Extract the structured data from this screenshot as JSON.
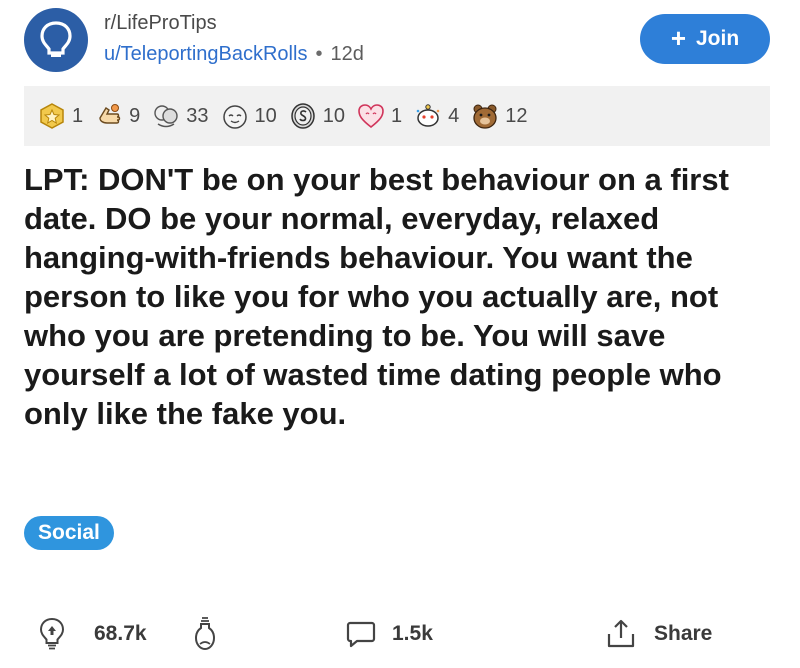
{
  "header": {
    "subreddit": "r/LifeProTips",
    "username": "u/TeleportingBackRolls",
    "separator": "•",
    "age": "12d",
    "join_plus": "+",
    "join_label": "Join",
    "avatar_icon": "lightbulb-icon"
  },
  "awards": [
    {
      "icon": "gold-medal-icon",
      "count": "1"
    },
    {
      "icon": "helpful-hand-icon",
      "count": "9"
    },
    {
      "icon": "wholesome-hug-icon",
      "count": "33"
    },
    {
      "icon": "silver-face-icon",
      "count": "10"
    },
    {
      "icon": "coin-icon",
      "count": "10"
    },
    {
      "icon": "heart-eyes-icon",
      "count": "1"
    },
    {
      "icon": "party-snoo-icon",
      "count": "4"
    },
    {
      "icon": "bear-icon",
      "count": "12"
    }
  ],
  "post": {
    "title": "LPT: DON'T be on your best behaviour on a first date. DO be your normal, everyday, relaxed hanging-with-friends behaviour. You want the person to like you for who you actually are, not who you are pretending to be. You will save yourself a lot of wasted time dating people who only like the fake you.",
    "flair": "Social"
  },
  "actions": {
    "score": "68.7k",
    "comments": "1.5k",
    "share": "Share"
  },
  "colors": {
    "join_button": "#2e7fd8",
    "flair": "#2f95de",
    "username": "#2f6fcc",
    "avatar": "#2c5ea6"
  }
}
